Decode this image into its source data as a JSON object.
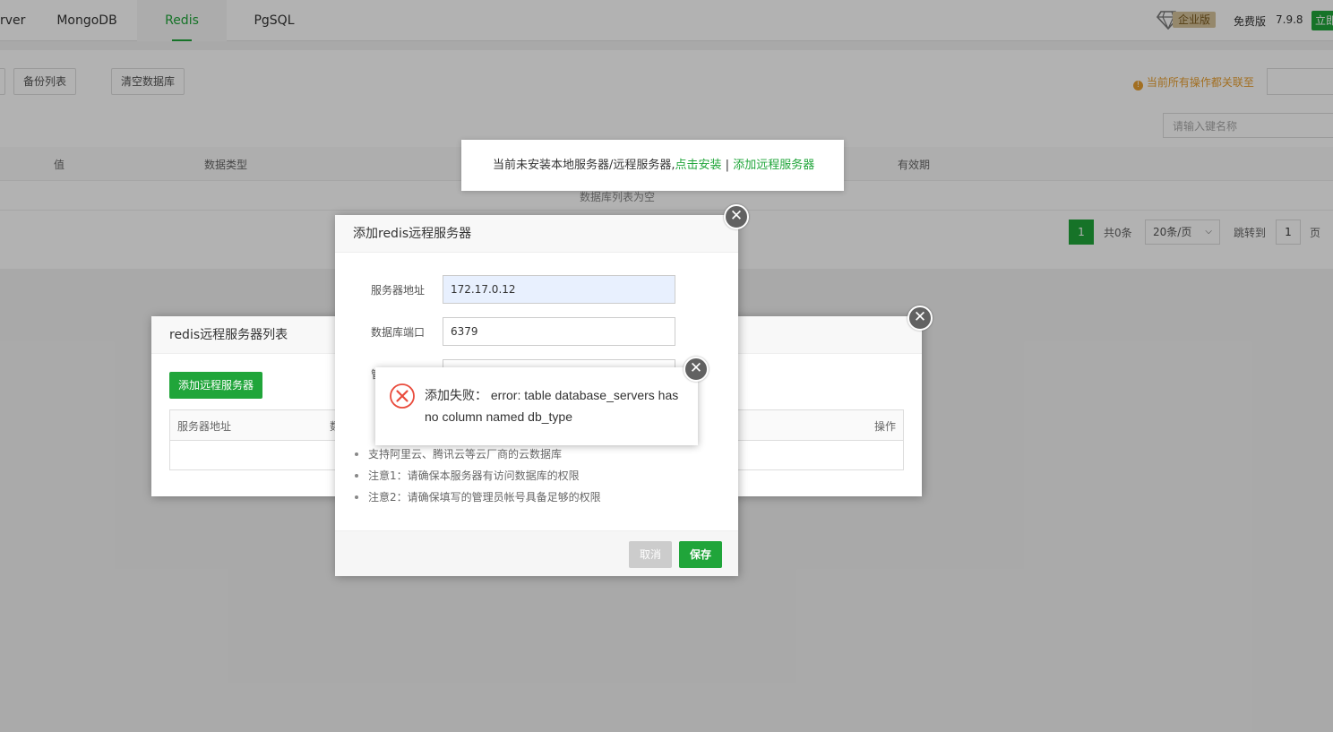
{
  "top_tabs": [
    {
      "label": "rver"
    },
    {
      "label": "MongoDB"
    },
    {
      "label": "Redis",
      "active": true
    },
    {
      "label": "PgSQL"
    }
  ],
  "top_right": {
    "enterprise_label": "企业版",
    "free_label": "免费版",
    "version": "7.9.8",
    "buy_label": "立即"
  },
  "toolbar": {
    "backup_list": "备份列表",
    "clear_db": "清空数据库",
    "notice": "当前所有操作都关联至",
    "search_placeholder": "请输入键名称"
  },
  "table": {
    "headers": [
      "值",
      "数据类型",
      "有效期"
    ],
    "empty_text": "数据库列表为空"
  },
  "pagination": {
    "current": "1",
    "total": "共0条",
    "per_page": "20条/页",
    "jump_label": "跳转到",
    "jump_value": "1",
    "page_unit": "页"
  },
  "tip_popup": {
    "text": "当前未安装本地服务器/远程服务器,",
    "install_link": "点击安装",
    "separator": " | ",
    "add_link": "添加远程服务器"
  },
  "server_list_dialog": {
    "title": "redis远程服务器列表",
    "add_button": "添加远程服务器",
    "col_address": "服务器地址",
    "col_db": "数",
    "col_action": "操作"
  },
  "add_server_dialog": {
    "title": "添加redis远程服务器",
    "fields": [
      {
        "label": "服务器地址",
        "value": "172.17.0.12"
      },
      {
        "label": "数据库端口",
        "value": "6379"
      },
      {
        "label": "管",
        "value": ""
      }
    ],
    "notes": [
      "支持阿里云、腾讯云等云厂商的云数据库",
      "注意1：请确保本服务器有访问数据库的权限",
      "注意2：请确保填写的管理员帐号具备足够的权限"
    ],
    "cancel_label": "取消",
    "save_label": "保存"
  },
  "error_dialog": {
    "message": "添加失败： error: table database_servers has no column named db_type"
  },
  "colors": {
    "accent": "#20a53a",
    "error": "#e94b3c",
    "close_button": "#626262"
  }
}
